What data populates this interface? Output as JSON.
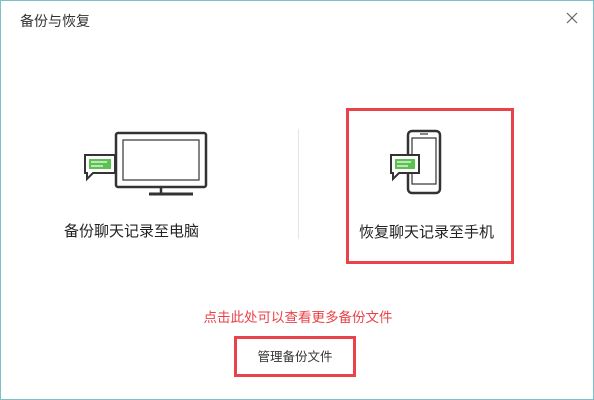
{
  "window": {
    "title": "备份与恢复"
  },
  "options": {
    "backup_to_pc": {
      "label": "备份聊天记录至电脑",
      "icon": "computer-chat-icon"
    },
    "restore_to_phone": {
      "label": "恢复聊天记录至手机",
      "icon": "phone-chat-icon"
    }
  },
  "hint": "点击此处可以查看更多备份文件",
  "manage": {
    "label": "管理备份文件"
  },
  "colors": {
    "accent_green": "#5bc24f",
    "highlight_red": "#e8434a",
    "icon_stroke": "#333333"
  }
}
